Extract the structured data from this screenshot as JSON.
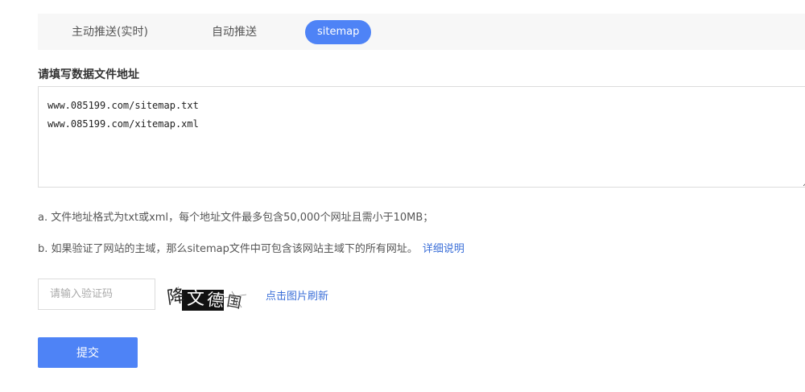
{
  "tabs": [
    {
      "label": "主动推送(实时)",
      "active": false
    },
    {
      "label": "自动推送",
      "active": false
    },
    {
      "label": "sitemap",
      "active": true
    }
  ],
  "form": {
    "section_label": "请填写数据文件地址",
    "urls_text": "www.085199.com/sitemap.txt\nwww.085199.com/xitemap.xml",
    "notes": {
      "a": "a. 文件地址格式为txt或xml，每个地址文件最多包含50,000个网址且需小于10MB；",
      "b": "b. 如果验证了网站的主域，那么sitemap文件中可包含该网站主域下的所有网址。",
      "detail_link": "详细说明"
    },
    "captcha": {
      "placeholder": "请输入验证码",
      "value": "",
      "image_text": "降文德国",
      "refresh_label": "点击图片刷新"
    },
    "submit_label": "提交"
  },
  "colors": {
    "accent": "#4e83f6",
    "link": "#3b6fd8",
    "tabbar_bg": "#f7f7f7"
  }
}
